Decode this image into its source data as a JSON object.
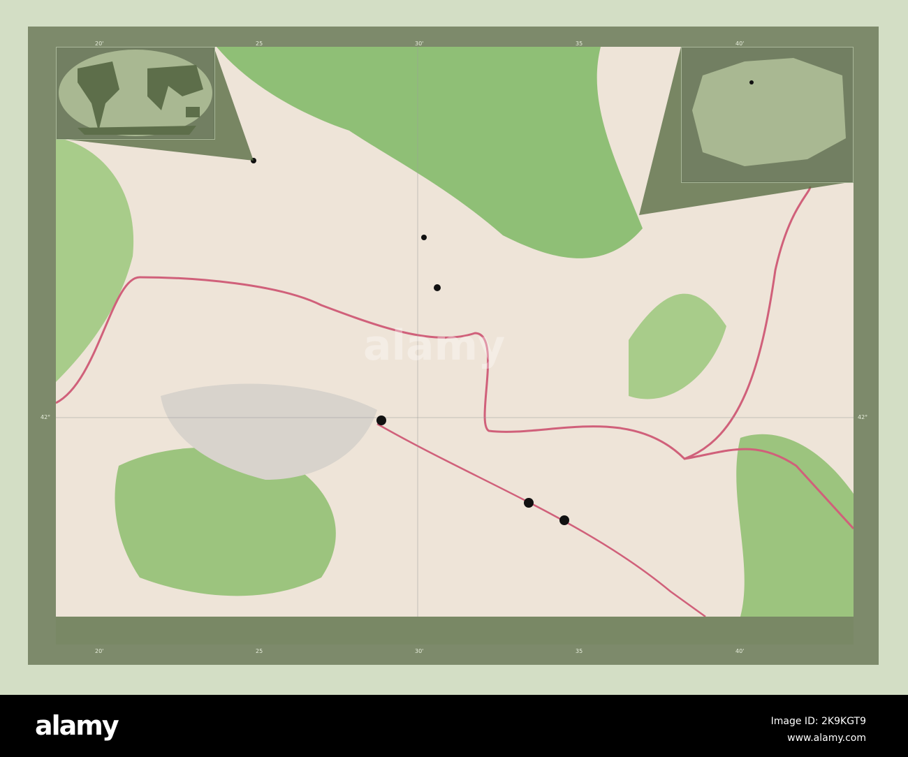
{
  "map": {
    "ticks_top": [
      "20'",
      "25",
      "30'",
      "35",
      "40'"
    ],
    "ticks_bottom": [
      "20'",
      "25",
      "30'",
      "35",
      "40'"
    ],
    "tick_side": "42°",
    "colors": {
      "land": "#eee4d8",
      "forest": "#8fbf76",
      "road": "#d0607a",
      "frame": "#7d8a6b",
      "bg": "#d3dec5"
    },
    "markers": [
      {
        "name": "marker-1"
      },
      {
        "name": "marker-2"
      },
      {
        "name": "marker-3"
      },
      {
        "name": "marker-4"
      },
      {
        "name": "marker-5"
      },
      {
        "name": "marker-6"
      }
    ]
  },
  "footer": {
    "logo": "alamy",
    "image_id": "Image ID: 2K9KGT9",
    "url": "www.alamy.com"
  },
  "watermark": "alamy"
}
